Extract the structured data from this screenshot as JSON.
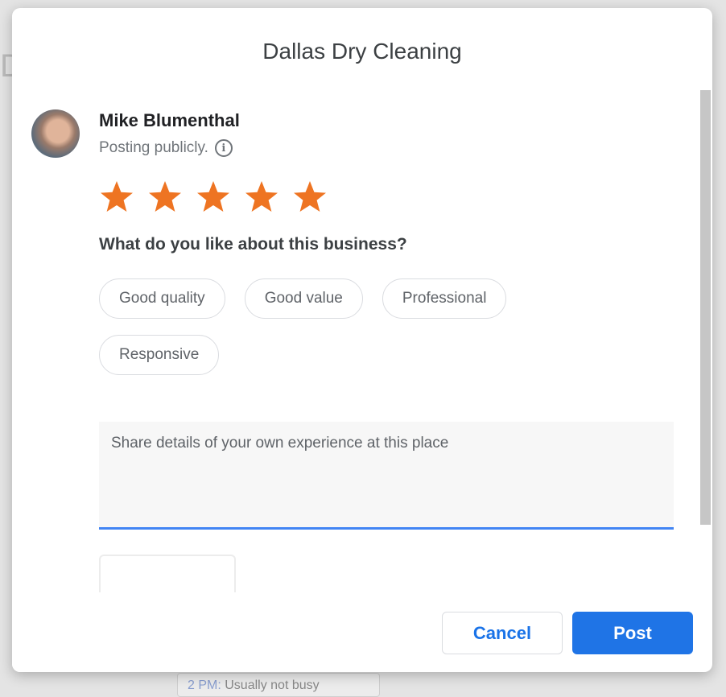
{
  "background": {
    "busy_time": "2 PM:",
    "busy_text": "Usually not busy"
  },
  "dialog": {
    "title": "Dallas Dry Cleaning",
    "user": {
      "name": "Mike Blumenthal",
      "posting_status": "Posting publicly."
    },
    "rating": {
      "value": 5,
      "max": 5,
      "star_color": "#ee7422"
    },
    "question": "What do you like about this business?",
    "chips": [
      "Good quality",
      "Good value",
      "Professional",
      "Responsive"
    ],
    "review": {
      "value": "",
      "placeholder": "Share details of your own experience at this place"
    },
    "buttons": {
      "cancel": "Cancel",
      "post": "Post"
    },
    "accent_color": "#1a73e8"
  }
}
